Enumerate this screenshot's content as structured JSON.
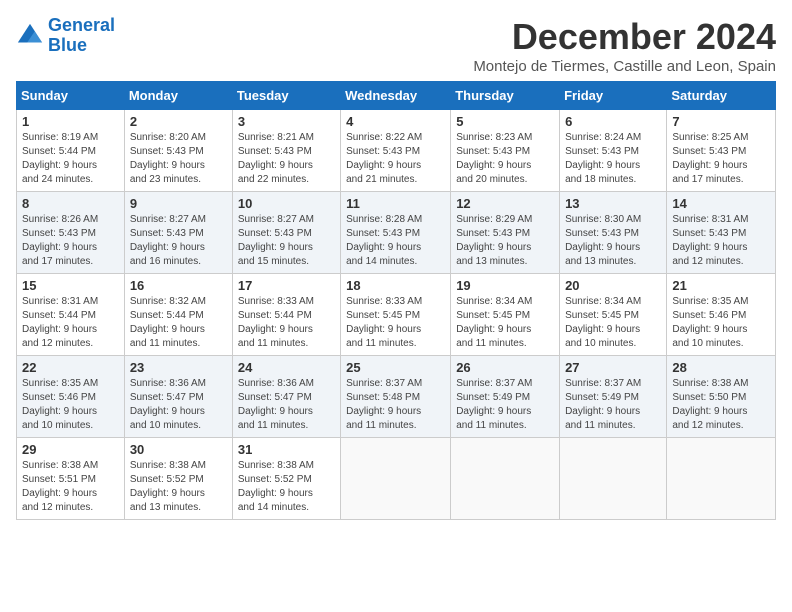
{
  "logo": {
    "line1": "General",
    "line2": "Blue"
  },
  "title": "December 2024",
  "subtitle": "Montejo de Tiermes, Castille and Leon, Spain",
  "days_of_week": [
    "Sunday",
    "Monday",
    "Tuesday",
    "Wednesday",
    "Thursday",
    "Friday",
    "Saturday"
  ],
  "weeks": [
    [
      {
        "day": "1",
        "info": "Sunrise: 8:19 AM\nSunset: 5:44 PM\nDaylight: 9 hours\nand 24 minutes."
      },
      {
        "day": "2",
        "info": "Sunrise: 8:20 AM\nSunset: 5:43 PM\nDaylight: 9 hours\nand 23 minutes."
      },
      {
        "day": "3",
        "info": "Sunrise: 8:21 AM\nSunset: 5:43 PM\nDaylight: 9 hours\nand 22 minutes."
      },
      {
        "day": "4",
        "info": "Sunrise: 8:22 AM\nSunset: 5:43 PM\nDaylight: 9 hours\nand 21 minutes."
      },
      {
        "day": "5",
        "info": "Sunrise: 8:23 AM\nSunset: 5:43 PM\nDaylight: 9 hours\nand 20 minutes."
      },
      {
        "day": "6",
        "info": "Sunrise: 8:24 AM\nSunset: 5:43 PM\nDaylight: 9 hours\nand 18 minutes."
      },
      {
        "day": "7",
        "info": "Sunrise: 8:25 AM\nSunset: 5:43 PM\nDaylight: 9 hours\nand 17 minutes."
      }
    ],
    [
      {
        "day": "8",
        "info": "Sunrise: 8:26 AM\nSunset: 5:43 PM\nDaylight: 9 hours\nand 17 minutes."
      },
      {
        "day": "9",
        "info": "Sunrise: 8:27 AM\nSunset: 5:43 PM\nDaylight: 9 hours\nand 16 minutes."
      },
      {
        "day": "10",
        "info": "Sunrise: 8:27 AM\nSunset: 5:43 PM\nDaylight: 9 hours\nand 15 minutes."
      },
      {
        "day": "11",
        "info": "Sunrise: 8:28 AM\nSunset: 5:43 PM\nDaylight: 9 hours\nand 14 minutes."
      },
      {
        "day": "12",
        "info": "Sunrise: 8:29 AM\nSunset: 5:43 PM\nDaylight: 9 hours\nand 13 minutes."
      },
      {
        "day": "13",
        "info": "Sunrise: 8:30 AM\nSunset: 5:43 PM\nDaylight: 9 hours\nand 13 minutes."
      },
      {
        "day": "14",
        "info": "Sunrise: 8:31 AM\nSunset: 5:43 PM\nDaylight: 9 hours\nand 12 minutes."
      }
    ],
    [
      {
        "day": "15",
        "info": "Sunrise: 8:31 AM\nSunset: 5:44 PM\nDaylight: 9 hours\nand 12 minutes."
      },
      {
        "day": "16",
        "info": "Sunrise: 8:32 AM\nSunset: 5:44 PM\nDaylight: 9 hours\nand 11 minutes."
      },
      {
        "day": "17",
        "info": "Sunrise: 8:33 AM\nSunset: 5:44 PM\nDaylight: 9 hours\nand 11 minutes."
      },
      {
        "day": "18",
        "info": "Sunrise: 8:33 AM\nSunset: 5:45 PM\nDaylight: 9 hours\nand 11 minutes."
      },
      {
        "day": "19",
        "info": "Sunrise: 8:34 AM\nSunset: 5:45 PM\nDaylight: 9 hours\nand 11 minutes."
      },
      {
        "day": "20",
        "info": "Sunrise: 8:34 AM\nSunset: 5:45 PM\nDaylight: 9 hours\nand 10 minutes."
      },
      {
        "day": "21",
        "info": "Sunrise: 8:35 AM\nSunset: 5:46 PM\nDaylight: 9 hours\nand 10 minutes."
      }
    ],
    [
      {
        "day": "22",
        "info": "Sunrise: 8:35 AM\nSunset: 5:46 PM\nDaylight: 9 hours\nand 10 minutes."
      },
      {
        "day": "23",
        "info": "Sunrise: 8:36 AM\nSunset: 5:47 PM\nDaylight: 9 hours\nand 10 minutes."
      },
      {
        "day": "24",
        "info": "Sunrise: 8:36 AM\nSunset: 5:47 PM\nDaylight: 9 hours\nand 11 minutes."
      },
      {
        "day": "25",
        "info": "Sunrise: 8:37 AM\nSunset: 5:48 PM\nDaylight: 9 hours\nand 11 minutes."
      },
      {
        "day": "26",
        "info": "Sunrise: 8:37 AM\nSunset: 5:49 PM\nDaylight: 9 hours\nand 11 minutes."
      },
      {
        "day": "27",
        "info": "Sunrise: 8:37 AM\nSunset: 5:49 PM\nDaylight: 9 hours\nand 11 minutes."
      },
      {
        "day": "28",
        "info": "Sunrise: 8:38 AM\nSunset: 5:50 PM\nDaylight: 9 hours\nand 12 minutes."
      }
    ],
    [
      {
        "day": "29",
        "info": "Sunrise: 8:38 AM\nSunset: 5:51 PM\nDaylight: 9 hours\nand 12 minutes."
      },
      {
        "day": "30",
        "info": "Sunrise: 8:38 AM\nSunset: 5:52 PM\nDaylight: 9 hours\nand 13 minutes."
      },
      {
        "day": "31",
        "info": "Sunrise: 8:38 AM\nSunset: 5:52 PM\nDaylight: 9 hours\nand 14 minutes."
      },
      {
        "day": "",
        "info": ""
      },
      {
        "day": "",
        "info": ""
      },
      {
        "day": "",
        "info": ""
      },
      {
        "day": "",
        "info": ""
      }
    ]
  ]
}
